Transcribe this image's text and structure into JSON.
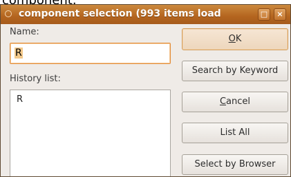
{
  "background_text": "component.",
  "window": {
    "title": "component selection (993 items load",
    "maximize_glyph": "□",
    "close_glyph": "×"
  },
  "form": {
    "name_label": "Name:",
    "name_value": "R",
    "history_label": "History list:",
    "history_items": [
      "R"
    ]
  },
  "buttons": {
    "ok": {
      "mnemonic": "O",
      "rest": "K"
    },
    "search_keyword": "Search by Keyword",
    "cancel": {
      "mnemonic": "C",
      "rest": "ancel"
    },
    "list_all": "List All",
    "select_browser": "Select by Browser"
  },
  "colors": {
    "titlebar": "#b4651f",
    "focus_border": "#e38e3a",
    "window_bg": "#efebe7"
  }
}
